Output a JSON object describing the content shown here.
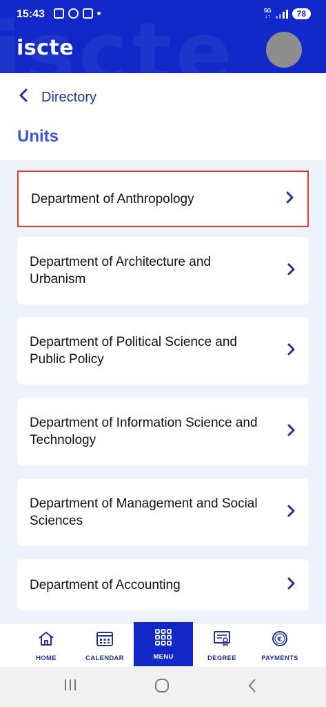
{
  "status_bar": {
    "time": "15:43",
    "network": "5G",
    "battery": "78"
  },
  "header": {
    "logo": "iscte",
    "watermark": "iscte",
    "brand_color": "#1228c8"
  },
  "nav": {
    "back_label": "Directory"
  },
  "page": {
    "title": "Units"
  },
  "units": [
    {
      "label": "Department of Anthropology",
      "selected": true
    },
    {
      "label": "Department of Architecture and Urbanism",
      "selected": false
    },
    {
      "label": "Department of Political Science and Public Policy",
      "selected": false
    },
    {
      "label": "Department of Information Science and Technology",
      "selected": false
    },
    {
      "label": "Department of Management and Social Sciences",
      "selected": false
    },
    {
      "label": "Department of Accounting",
      "selected": false
    }
  ],
  "bottom_nav": {
    "items": [
      {
        "label": "HOME",
        "icon": "home-icon",
        "active": false
      },
      {
        "label": "CALENDAR",
        "icon": "calendar-icon",
        "active": false
      },
      {
        "label": "MENU",
        "icon": "grid-menu-icon",
        "active": true
      },
      {
        "label": "DEGREE",
        "icon": "certificate-icon",
        "active": false
      },
      {
        "label": "PAYMENTS",
        "icon": "euro-coin-icon",
        "active": false
      }
    ]
  },
  "system_nav": {
    "recents_icon": "recents-icon",
    "home_icon": "home-circle-icon",
    "back_icon": "back-chevron-icon"
  }
}
